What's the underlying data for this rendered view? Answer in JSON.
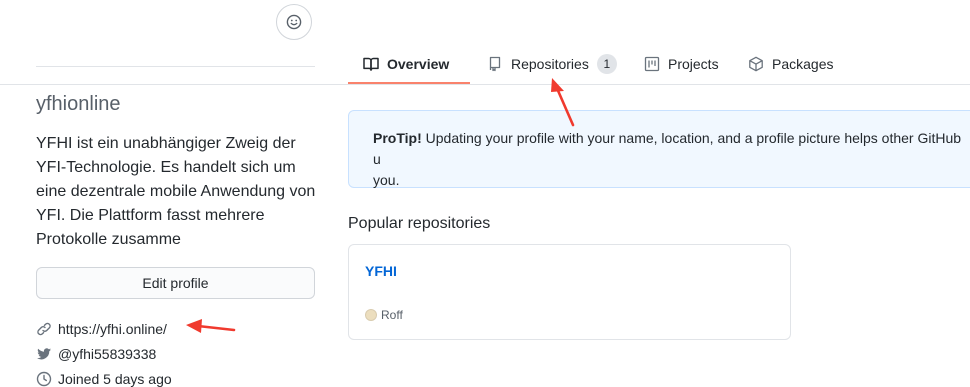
{
  "emoji_status": {
    "icon": "smiley-icon"
  },
  "tabs": [
    {
      "label": "Overview",
      "icon": "book-icon",
      "selected": true
    },
    {
      "label": "Repositories",
      "icon": "repo-icon",
      "count": "1"
    },
    {
      "label": "Projects",
      "icon": "project-icon"
    },
    {
      "label": "Packages",
      "icon": "package-icon"
    }
  ],
  "profile": {
    "username": "yfhionline",
    "bio": "YFHI ist ein unabhängiger Zweig der YFI-Technologie. Es handelt sich um eine dezentrale mobile Anwendung von YFI. Die Plattform fasst mehrere Protokolle zusamme",
    "edit_button": "Edit profile",
    "website": "https://yfhi.online/",
    "twitter": "@yfhi55839338",
    "joined": "Joined 5 days ago"
  },
  "protip": {
    "label": "ProTip!",
    "text": " Updating your profile with your name, location, and a profile picture helps other GitHub u",
    "text2": "you."
  },
  "popular": {
    "heading": "Popular repositories",
    "repos": [
      {
        "name": "YFHI",
        "language": "Roff",
        "language_color": "#ecdebe"
      }
    ]
  },
  "colors": {
    "accent_underline": "#f9826c",
    "link": "#0366d6",
    "annotation_arrow": "#f03a2e"
  }
}
